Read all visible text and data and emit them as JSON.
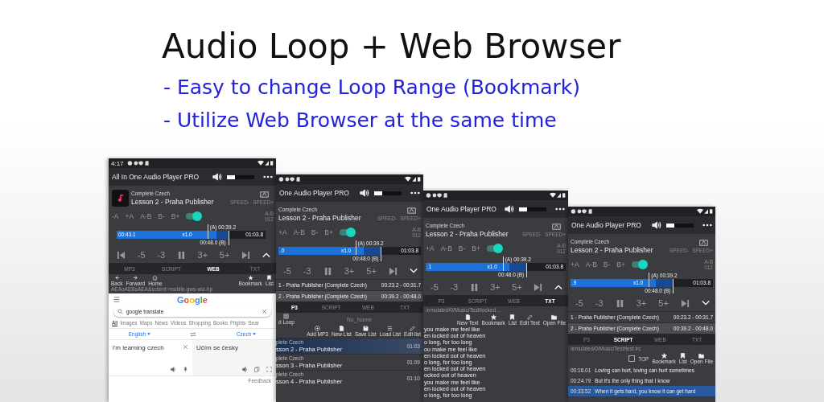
{
  "banner": {
    "title": "Audio Loop + Web Browser",
    "points": [
      "- Easy to change Loop Range (Bookmark)",
      "- Utilize Web Browser at the same time"
    ]
  },
  "phones": [
    {
      "status_time": "4:17",
      "title": "All In One Audio Player PRO",
      "volume": {
        "level": 0.3
      },
      "artwork": true,
      "album": "Complete Czech",
      "track": "Lesson 2 - Praha Publisher",
      "speed_buttons": [
        "SPEED-",
        "SPEED+"
      ],
      "ab_buttons": [
        "-A",
        "+A",
        "A-B",
        "B-",
        "B+"
      ],
      "loop_on": true,
      "ab_counter": [
        "A-B",
        "012"
      ],
      "a_label": "(A) 00:39.2",
      "b_label": "00:48.0 (B)",
      "position": {
        "level": 0.67
      },
      "a_point": {
        "level": 0.61
      },
      "b_point": {
        "level": 0.75
      },
      "time_start": "00:43.1",
      "speed": "x1.0",
      "time_end": "01:03.8",
      "skip_back": true,
      "controls": [
        "-5",
        "-3",
        "3+",
        "5+"
      ],
      "bookmarks_open": false,
      "tabs": [
        {
          "label": "MP3",
          "selected": false
        },
        {
          "label": "SCRIPT",
          "selected": false
        },
        {
          "label": "WEB",
          "selected": true
        },
        {
          "label": "TXT",
          "selected": false
        }
      ],
      "content": {
        "kind": "web",
        "nav": [
          {
            "kind": "back",
            "label": "Back"
          },
          {
            "kind": "forward",
            "label": "Forward"
          },
          {
            "kind": "home",
            "label": "Home"
          }
        ],
        "url": "AEAoAEBsAEA&sclient=mobile-gws-wiz-hp",
        "tools": [
          {
            "kind": "star",
            "label": "Bookmark"
          },
          {
            "kind": "bookmark",
            "label": "List"
          }
        ],
        "google": {
          "logo": "Google",
          "query": "google translate",
          "tabs": [
            {
              "label": "All",
              "selected": true
            },
            {
              "label": "Images",
              "selected": false
            },
            {
              "label": "Maps",
              "selected": false
            },
            {
              "label": "News",
              "selected": false
            },
            {
              "label": "Videos",
              "selected": false
            },
            {
              "label": "Shopping",
              "selected": false
            },
            {
              "label": "Books",
              "selected": false
            },
            {
              "label": "Flights",
              "selected": false
            },
            {
              "label": "Sear",
              "selected": false
            }
          ],
          "source_lang": "English",
          "target_lang": "Czech",
          "source_text": "i'm learning czech",
          "translation": "Učím se česky",
          "feedback": "Feedback"
        }
      }
    },
    {
      "title": "One Audio Player PRO",
      "volume": {
        "level": 0.3
      },
      "album": "Complete Czech",
      "track": "Lesson 2 - Praha Publisher",
      "speed_buttons": [
        "SPEED-",
        "SPEED+"
      ],
      "ab_buttons": [
        "+A",
        "A-B",
        "B-",
        "B+"
      ],
      "loop_on": true,
      "ab_counter": [
        "A-B",
        "012"
      ],
      "a_label": "(A) 00:39.2",
      "b_label": "00:48.0 (B)",
      "position": {
        "level": 0.6
      },
      "a_point": {
        "level": 0.54
      },
      "b_point": {
        "level": 0.72
      },
      "time_start": ".0",
      "speed": "x1.0",
      "time_end": "01:03.8",
      "controls": [
        "-5",
        "-3",
        "3+",
        "5+"
      ],
      "bookmarks_open": true,
      "bookmarks": [
        {
          "name": "1 - Praha Publisher (Complete Czech)",
          "range": "00:23.2 - 00:31.7",
          "selected": false
        },
        {
          "name": "2 - Praha Publisher (Complete Czech)",
          "range": "00:39.2 - 00:48.0",
          "selected": true
        }
      ],
      "tabs": [
        {
          "label": "P3",
          "selected": true
        },
        {
          "label": "SCRIPT",
          "selected": false
        },
        {
          "label": "WEB",
          "selected": false
        },
        {
          "label": "TXT",
          "selected": false
        }
      ],
      "content": {
        "kind": "list",
        "lead": {
          "kind": "loop",
          "label": "d Loop"
        },
        "list_name": "No_Name",
        "tools": [
          {
            "kind": "add",
            "label": "Add MP3"
          },
          {
            "kind": "file",
            "label": "New List"
          },
          {
            "kind": "save",
            "label": "Save List"
          },
          {
            "kind": "list",
            "label": "Load List"
          },
          {
            "kind": "edit",
            "label": "Edit list"
          }
        ],
        "items": [
          {
            "album": "plete Czech",
            "title": "sson 2 - Praha Publisher",
            "duration": "01:03",
            "selected": true
          },
          {
            "album": "plete Czech",
            "title": "sson 3 - Praha Publisher",
            "duration": "01:09",
            "selected": false
          },
          {
            "album": "plete Czech",
            "title": "sson 4 - Praha Publisher",
            "duration": "01:10",
            "selected": false
          }
        ]
      }
    },
    {
      "title": "One Audio Player PRO",
      "volume": {
        "level": 0.3
      },
      "album": "Complete Czech",
      "track": "Lesson 2 - Praha Publisher",
      "speed_buttons": [
        "SPEED-",
        "SPEED+"
      ],
      "ab_buttons": [
        "+A",
        "A-B",
        "B-",
        "B+"
      ],
      "loop_on": true,
      "ab_counter": [
        "A-B",
        "012"
      ],
      "a_label": "(A) 00:39.2",
      "b_label": "00:48.0 (B)",
      "position": {
        "level": 0.6
      },
      "a_point": {
        "level": 0.55
      },
      "b_point": {
        "level": 0.72
      },
      "time_start": ".1",
      "speed": "x1.0",
      "time_end": "01:03.8",
      "controls": [
        "-5",
        "-3",
        "3+",
        "5+"
      ],
      "bookmarks_open": false,
      "tabs": [
        {
          "label": "P3",
          "selected": false
        },
        {
          "label": "SCRIPT",
          "selected": false
        },
        {
          "label": "WEB",
          "selected": false
        },
        {
          "label": "TXT",
          "selected": true
        }
      ],
      "content": {
        "kind": "txt",
        "path": "/emulated/0/Music/Test/locked ...",
        "tools": [
          {
            "kind": "file",
            "label": "New Text"
          },
          {
            "kind": "star",
            "label": "Bookmark"
          },
          {
            "kind": "bookmark",
            "label": "List"
          },
          {
            "kind": "edit",
            "label": "Edit Text"
          },
          {
            "kind": "folder",
            "label": "Open File"
          }
        ],
        "lines": [
          "you make me feel like",
          "en locked out of heaven",
          "o long, for too long",
          "ou make me feel like",
          "en locked out of heaven",
          "o long, for too long",
          "en locked out of heaven",
          "ocked out of heaven",
          "you make me feel like",
          "en locked out of heaven",
          "o long, for too long"
        ]
      }
    },
    {
      "title": "One Audio Player PRO",
      "volume": {
        "level": 0.3
      },
      "album": "Complete Czech",
      "track": "Lesson 2 - Praha Publisher",
      "speed_buttons": [
        "SPEED-",
        "SPEED+"
      ],
      "ab_buttons": [
        "+A",
        "A-B",
        "B-",
        "B+"
      ],
      "loop_on": true,
      "ab_counter": [
        "A-B",
        "012"
      ],
      "a_label": "(A) 00:39.2",
      "b_label": "00:48.0 (B)",
      "position": {
        "level": 0.6
      },
      "a_point": {
        "level": 0.55
      },
      "b_point": {
        "level": 0.72
      },
      "time_start": ".9",
      "speed": "x1.0",
      "time_end": "01:03.8",
      "controls": [
        "-5",
        "-3",
        "3+",
        "5+"
      ],
      "bookmarks_open": true,
      "bookmarks": [
        {
          "name": "1 - Praha Publisher (Complete Czech)",
          "range": "00:23.2 - 00:31.7",
          "selected": false
        },
        {
          "name": "2 - Praha Publisher (Complete Czech)",
          "range": "00:39.2 - 00:48.0",
          "selected": true
        }
      ],
      "tabs": [
        {
          "label": "P3",
          "selected": false
        },
        {
          "label": "SCRIPT",
          "selected": true
        },
        {
          "label": "WEB",
          "selected": false
        },
        {
          "label": "TXT",
          "selected": false
        }
      ],
      "content": {
        "kind": "script",
        "path": "/emulated/0/Music/Test/test.lrc",
        "top": {
          "label": "TOP",
          "checked": false
        },
        "tools": [
          {
            "kind": "star",
            "label": "Bookmark"
          },
          {
            "kind": "bookmark",
            "label": "List"
          },
          {
            "kind": "folder",
            "label": "Open File"
          }
        ],
        "lines": [
          {
            "time": "00:16.01",
            "text": "Loving can hurt, loving can hurt sometimes",
            "selected": false
          },
          {
            "time": "00:24.79",
            "text": "But it's the only thing that I know",
            "selected": false
          },
          {
            "time": "00:33.52",
            "text": "When it gets hard, you know it can get hard",
            "selected": true
          }
        ]
      }
    }
  ]
}
